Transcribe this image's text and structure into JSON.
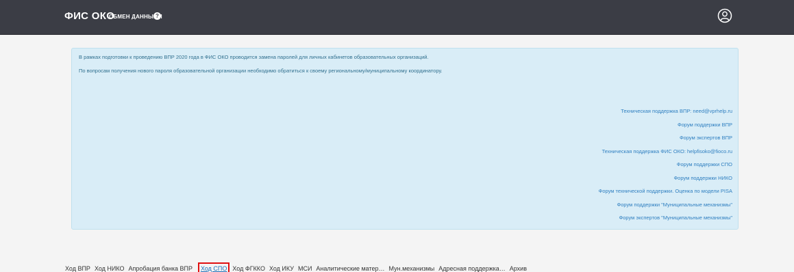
{
  "header": {
    "brand": "ФИС ОКО",
    "exchange_label": "ОБМЕН ДАННЫМИ",
    "help_icon": "question-circle-icon",
    "user_icon": "user-circle-icon"
  },
  "notice": {
    "line1": "В рамках подготовки к проведению ВПР 2020 года в ФИС ОКО проводится замена паролей для личных кабинетов образовательных организаций.",
    "line2": "По вопросам получения нового пароля образовательной организации необходимо обратиться к своему региональному/муниципальному координатору."
  },
  "support_links": [
    "Техническая поддержка ВПР: need@vprhelp.ru",
    "Форум поддержки ВПР",
    "Форум экспертов ВПР",
    "Техническая поддержка ФИС ОКО: helpfisoko@fioco.ru",
    "Форум поддержки СПО",
    "Форум поддержки НИКО",
    "Форум технической поддержки. Оценка по модели PISA",
    "Форум поддержки \"Муниципальные механизмы\"",
    "Форум экспертов \"Муниципальные механизмы\""
  ],
  "tabs": [
    "Ход ВПР",
    "Ход НИКО",
    "Апробация банка ВПР",
    "Ход СПО",
    "Ход ФГККО",
    "Ход ИКУ",
    "МСИ",
    "Аналитические матер…",
    "Мун.механизмы",
    "Адресная поддержка…",
    "Архив"
  ],
  "active_tab": "Ход СПО",
  "colors": {
    "topbar": "#3b3d45",
    "info_bg": "#d9edf7",
    "link": "#2f7fc0",
    "highlight": "#e01010"
  }
}
